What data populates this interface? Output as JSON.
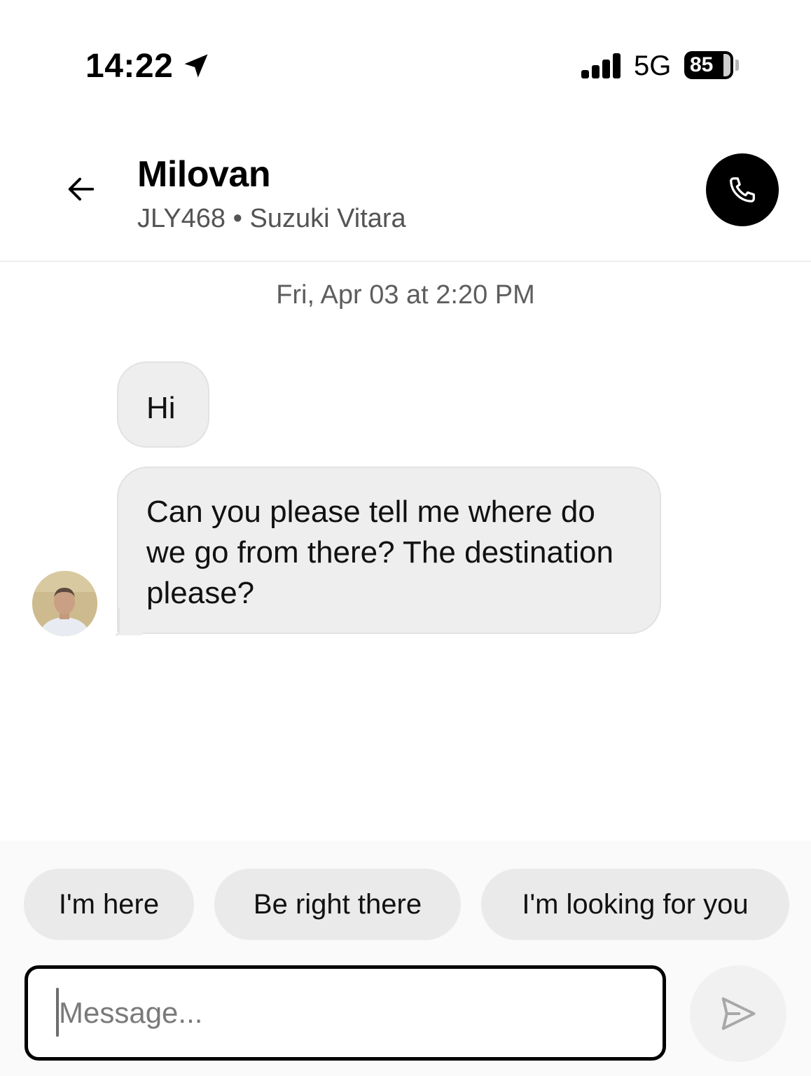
{
  "status_bar": {
    "time": "14:22",
    "network": "5G",
    "battery": "85"
  },
  "header": {
    "back_icon": "arrow-left-icon",
    "driver_name": "Milovan",
    "vehicle_info": "JLY468 • Suzuki Vitara",
    "call_icon": "phone-icon"
  },
  "chat": {
    "timestamp": "Fri, Apr 03 at 2:20 PM",
    "messages": [
      {
        "sender": "driver",
        "text": "Hi"
      },
      {
        "sender": "driver",
        "text": "Can you please tell me where do we go from there? The destination please?"
      }
    ]
  },
  "quick_replies": [
    "I'm here",
    "Be right there",
    "I'm looking for you"
  ],
  "composer": {
    "value": "",
    "placeholder": "Message...",
    "send_icon": "send-icon"
  },
  "colors": {
    "bubble": "#eeeeee",
    "chip": "#eaeaea",
    "call_button": "#000000",
    "send_button": "#f1f1f1"
  }
}
